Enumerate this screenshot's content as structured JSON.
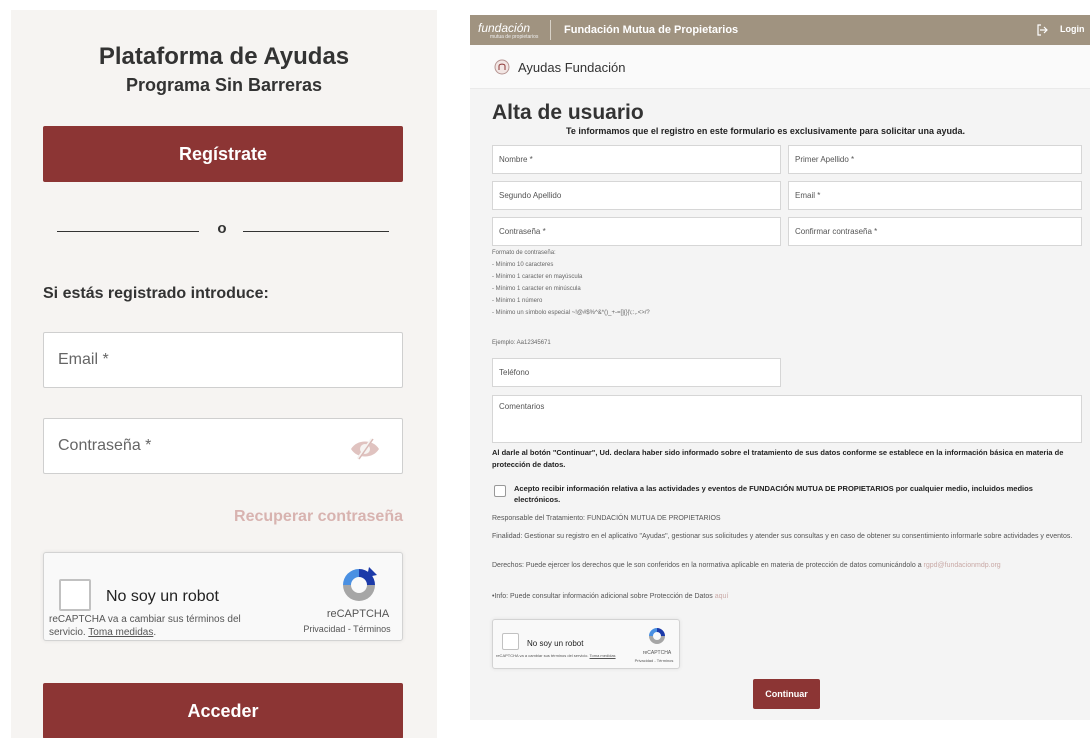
{
  "login": {
    "title": "Plataforma de Ayudas",
    "subtitle": "Programa Sin Barreras",
    "register_label": "Regístrate",
    "or_label": "o",
    "prompt": "Si estás registrado introduce:",
    "email_placeholder": "Email *",
    "password_placeholder": "Contraseña *",
    "recover_label": "Recuperar contraseña",
    "access_label": "Acceder"
  },
  "captcha": {
    "label": "No soy un robot",
    "notice": "reCAPTCHA va a cambiar sus términos del servicio.",
    "notice_link": "Toma medidas",
    "brand": "reCAPTCHA",
    "links": "Privacidad - Términos"
  },
  "header": {
    "logo_text": "fundación",
    "logo_sub": "mutua de propietarios",
    "title": "Fundación Mutua de Propietarios",
    "login_label": "Login"
  },
  "subheader": {
    "title": "Ayudas Fundación"
  },
  "register": {
    "title": "Alta de usuario",
    "info": "Te informamos que el registro en este formulario es exclusivamente para solicitar una ayuda.",
    "fields": {
      "nombre": "Nombre *",
      "primer_apellido": "Primer Apellido *",
      "segundo_apellido": "Segundo Apellido",
      "email": "Email *",
      "password": "Contraseña *",
      "confirm_password": "Confirmar contraseña *",
      "telefono": "Teléfono",
      "comentarios": "Comentarios"
    },
    "password_rules_title": "Formato de contraseña:",
    "password_rules": [
      "- Mínimo 10 caracteres",
      "- Mínimo 1 caracter en mayúscula",
      "- Mínimo 1 caracter en minúscula",
      "- Mínimo 1 número",
      "- Mínimo un símbolo especial ~!@#$%^&*()_+-=[]{}|\\;:,.<>/?"
    ],
    "password_example": "Ejemplo: Aa12345671",
    "legal_notice": "Al darle al botón \"Continuar\", Ud. declara haber sido informado sobre el tratamiento de sus datos conforme se establece en la información básica en materia de protección de datos.",
    "consent_label": "Acepto recibir información relativa a las actividades y eventos de FUNDACIÓN MUTUA DE PROPIETARIOS por cualquier medio, incluidos medios electrónicos.",
    "responsable": "Responsable del Tratamiento: FUNDACIÓN MUTUA DE PROPIETARIOS",
    "finalidad": "Finalidad: Gestionar su registro en el aplicativo \"Ayudas\", gestionar sus solicitudes y atender sus consultas y en caso de obtener su consentimiento informarle sobre actividades y eventos.",
    "derechos": "Derechos: Puede ejercer los derechos que le son conferidos en la normativa aplicable en materia de protección de datos comunicándolo a",
    "derechos_email": "rgpd@fundacionmdp.org",
    "info_extra": "•Info: Puede consultar información adicional sobre Protección de Datos",
    "info_link": "aquí",
    "continue_label": "Continuar"
  },
  "colors": {
    "primary": "#8c3534",
    "header": "#a09380",
    "link_muted": "#d8b3b0",
    "recaptcha_blue": "#1c3aa9",
    "recaptcha_grey": "#a6a6a6",
    "recaptcha_lightblue": "#4a90e2"
  },
  "icons": {
    "password_toggle": "eye-slash-icon",
    "login": "logout-arrow-icon",
    "subheader": "home-circle-icon",
    "recaptcha": "recaptcha-logo-icon"
  }
}
